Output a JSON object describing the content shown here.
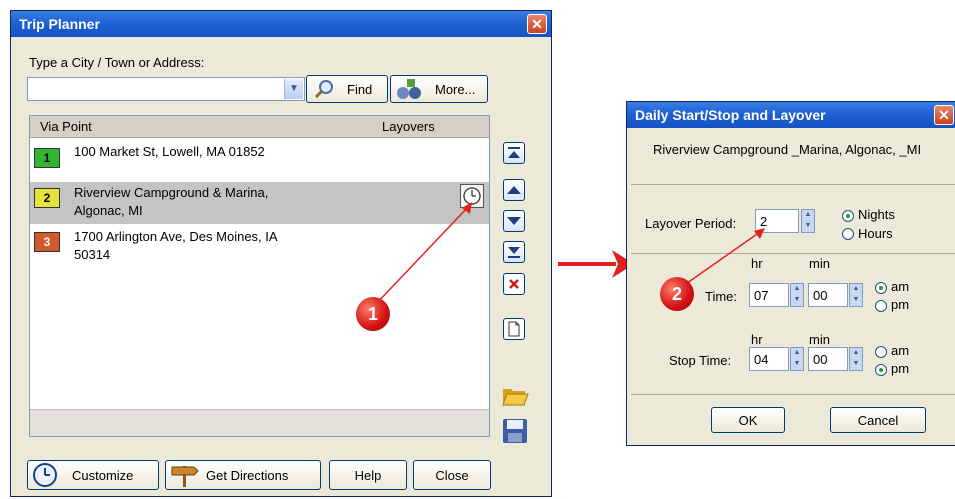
{
  "trip_planner": {
    "title": "Trip Planner",
    "close_glyph": "✕",
    "address_label": "Type a City / Town or Address:",
    "address_value": "",
    "find_label": "Find",
    "more_label": "More...",
    "columns": {
      "via": "Via Point",
      "layovers": "Layovers"
    },
    "via_points": [
      {
        "num": "1",
        "color": "#33b533",
        "line1": "100 Market St, Lowell, MA 01852",
        "line2": ""
      },
      {
        "num": "2",
        "color": "#e4e43a",
        "line1": "Riverview Campground & Marina,",
        "line2": "Algonac, MI"
      },
      {
        "num": "3",
        "color": "#d05a2a",
        "line1": "1700 Arlington Ave, Des Moines, IA",
        "line2": "50314"
      }
    ],
    "buttons": {
      "customize": "Customize",
      "get_directions": "Get Directions",
      "help": "Help",
      "close": "Close"
    },
    "side_icons": [
      "move-top-icon",
      "move-up-icon",
      "move-down-icon",
      "move-bottom-icon",
      "delete-icon",
      "new-document-icon",
      "open-folder-icon",
      "save-icon"
    ]
  },
  "layover_dialog": {
    "title": "Daily Start/Stop and  Layover",
    "location": "Riverview Campground _Marina, Algonac, _MI",
    "layover_label": "Layover Period:",
    "layover_value": "2",
    "nights_label": "Nights",
    "hours_label": "Hours",
    "unit_selected": "Nights",
    "hr_label": "hr",
    "min_label": "min",
    "start_label": "Time:",
    "start_hr": "07",
    "start_min": "00",
    "start_ampm": "am",
    "stop_label": "Stop Time:",
    "stop_hr": "04",
    "stop_min": "00",
    "stop_ampm": "pm",
    "am_label": "am",
    "pm_label": "pm",
    "ok": "OK",
    "cancel": "Cancel"
  },
  "callouts": [
    "1",
    "2"
  ],
  "colors": {
    "arrow": "#e32020",
    "title_blue": "#1c5fd2",
    "selected_row": "#c4c4c4"
  }
}
